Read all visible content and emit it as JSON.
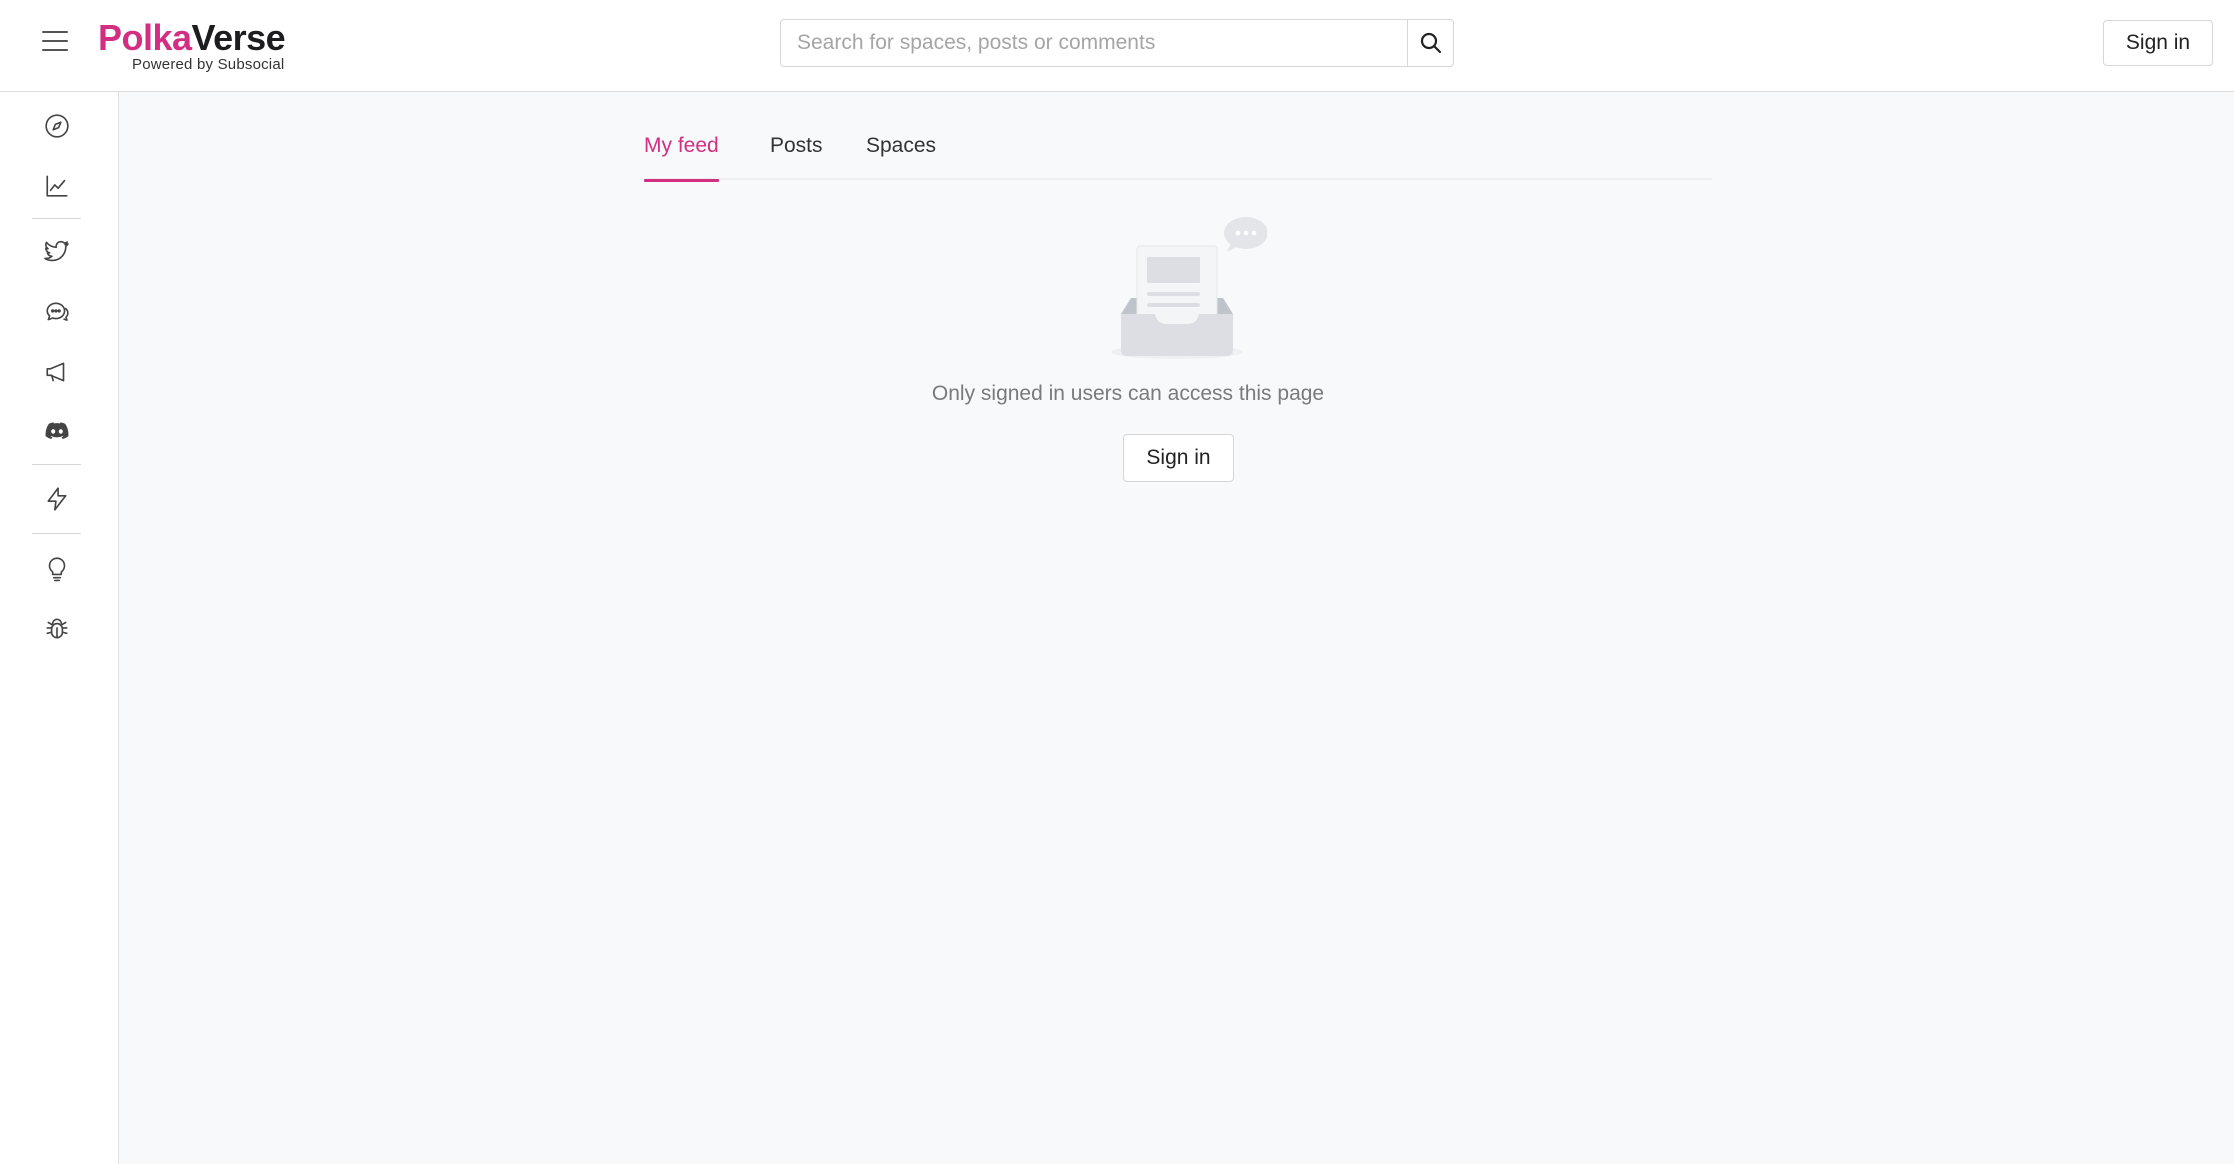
{
  "brand": {
    "name_part1": "Polka",
    "name_part2": "Verse",
    "tagline": "Powered by Subsocial",
    "accent_color": "#d22f82"
  },
  "header": {
    "menu_icon": "hamburger-menu-icon",
    "search": {
      "placeholder": "Search for spaces, posts or comments",
      "value": "",
      "icon": "search-icon"
    },
    "sign_in_label": "Sign in"
  },
  "sidebar": {
    "items": [
      {
        "name": "explore",
        "icon": "compass-icon"
      },
      {
        "name": "stats",
        "icon": "line-chart-icon"
      },
      {
        "name": "twitter",
        "icon": "twitter-icon"
      },
      {
        "name": "chat",
        "icon": "chat-bubbles-icon"
      },
      {
        "name": "announcements",
        "icon": "megaphone-icon"
      },
      {
        "name": "discord",
        "icon": "discord-icon"
      },
      {
        "name": "energy",
        "icon": "lightning-icon"
      },
      {
        "name": "ideas",
        "icon": "lightbulb-icon"
      },
      {
        "name": "bug-report",
        "icon": "bug-icon"
      }
    ]
  },
  "main": {
    "tabs": [
      {
        "label": "My feed",
        "active": true
      },
      {
        "label": "Posts",
        "active": false
      },
      {
        "label": "Spaces",
        "active": false
      }
    ],
    "empty_state": {
      "message": "Only signed in users can access this page",
      "button_label": "Sign in",
      "illustration": "empty-inbox-icon"
    }
  }
}
